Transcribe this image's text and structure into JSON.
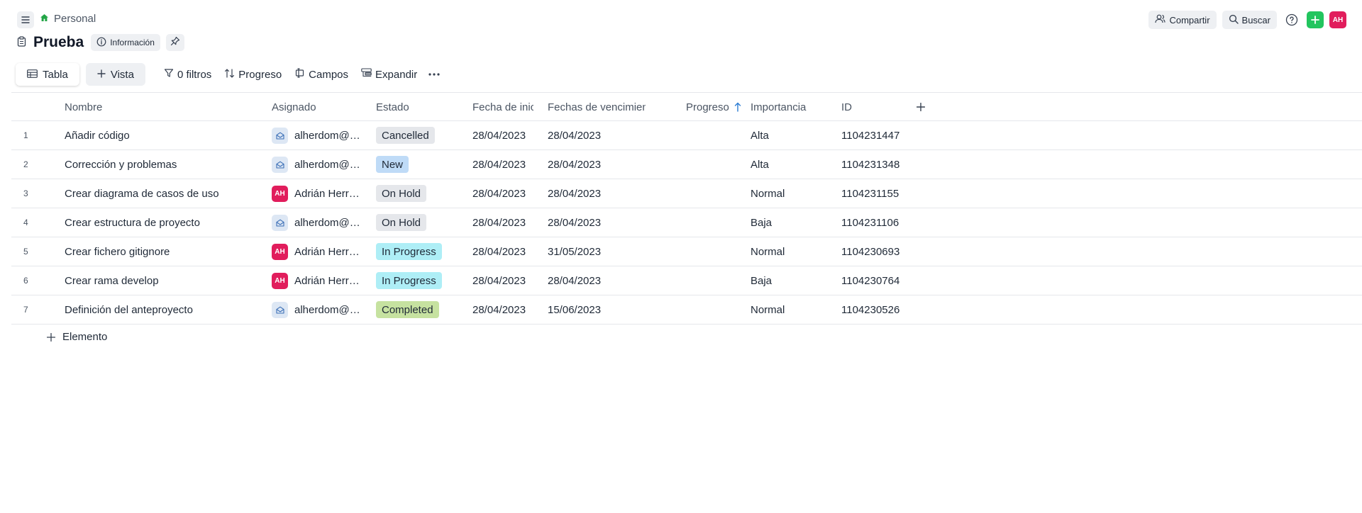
{
  "breadcrumb": {
    "workspace": "Personal"
  },
  "top_actions": {
    "share_label": "Compartir",
    "search_label": "Buscar",
    "avatar_initials": "AH"
  },
  "page": {
    "title": "Prueba",
    "info_label": "Información"
  },
  "toolbar": {
    "table_tab": "Tabla",
    "add_view": "Vista",
    "filters": "0 filtros",
    "sort": "Progreso",
    "fields": "Campos",
    "expand": "Expandir"
  },
  "columns": {
    "name": "Nombre",
    "assignee": "Asignado",
    "status": "Estado",
    "start": "Fecha de inicio",
    "due": "Fechas de vencimiento",
    "progress": "Progreso",
    "importance": "Importancia",
    "id": "ID"
  },
  "rows": [
    {
      "num": "1",
      "name": "Añadir código",
      "assignee": "alherdom@outlook.com",
      "avatar": "mail",
      "status": "Cancelled",
      "start": "28/04/2023",
      "due": "28/04/2023",
      "progress": "",
      "importance": "Alta",
      "id": "1104231447"
    },
    {
      "num": "2",
      "name": "Corrección y problemas",
      "assignee": "alherdom@outlook.com",
      "avatar": "mail",
      "status": "New",
      "start": "28/04/2023",
      "due": "28/04/2023",
      "progress": "",
      "importance": "Alta",
      "id": "1104231348"
    },
    {
      "num": "3",
      "name": "Crear diagrama de casos de uso",
      "assignee": "Adrián Herrera",
      "avatar": "AH",
      "status": "On Hold",
      "start": "28/04/2023",
      "due": "28/04/2023",
      "progress": "",
      "importance": "Normal",
      "id": "1104231155"
    },
    {
      "num": "4",
      "name": "Crear estructura de proyecto",
      "assignee": "alherdom@outlook.com",
      "avatar": "mail",
      "status": "On Hold",
      "start": "28/04/2023",
      "due": "28/04/2023",
      "progress": "",
      "importance": "Baja",
      "id": "1104231106"
    },
    {
      "num": "5",
      "name": "Crear fichero gitignore",
      "assignee": "Adrián Herrera",
      "avatar": "AH",
      "status": "In Progress",
      "start": "28/04/2023",
      "due": "31/05/2023",
      "progress": "",
      "importance": "Normal",
      "id": "1104230693"
    },
    {
      "num": "6",
      "name": "Crear rama develop",
      "assignee": "Adrián Herrera",
      "avatar": "AH",
      "status": "In Progress",
      "start": "28/04/2023",
      "due": "28/04/2023",
      "progress": "",
      "importance": "Baja",
      "id": "1104230764"
    },
    {
      "num": "7",
      "name": "Definición del anteproyecto",
      "assignee": "alherdom@outlook.com",
      "avatar": "mail",
      "status": "Completed",
      "start": "28/04/2023",
      "due": "15/06/2023",
      "progress": "",
      "importance": "Normal",
      "id": "1104230526"
    }
  ],
  "status_colors": {
    "Cancelled": "#e5e7eb",
    "New": "#bfdbf7",
    "On Hold": "#e5e7eb",
    "In Progress": "#aeeef6",
    "Completed": "#c6e2a0"
  },
  "colors": {
    "accent_green": "#22c55e",
    "avatar_pink": "#e11d5c",
    "sort_arrow_blue": "#2b7cd3"
  },
  "add_item_label": "Elemento",
  "icons": {
    "menu": "hamburger-icon",
    "home": "home-icon",
    "share": "people-icon",
    "search": "search-icon",
    "help": "help-icon",
    "add": "plus-icon",
    "page": "clipboard-icon",
    "info": "info-icon",
    "pin": "pin-icon",
    "table": "table-icon",
    "filter": "filter-icon",
    "sort": "sort-icon",
    "fields": "fields-icon",
    "expand": "expand-icon",
    "more": "more-icon",
    "mail": "mail-icon"
  }
}
